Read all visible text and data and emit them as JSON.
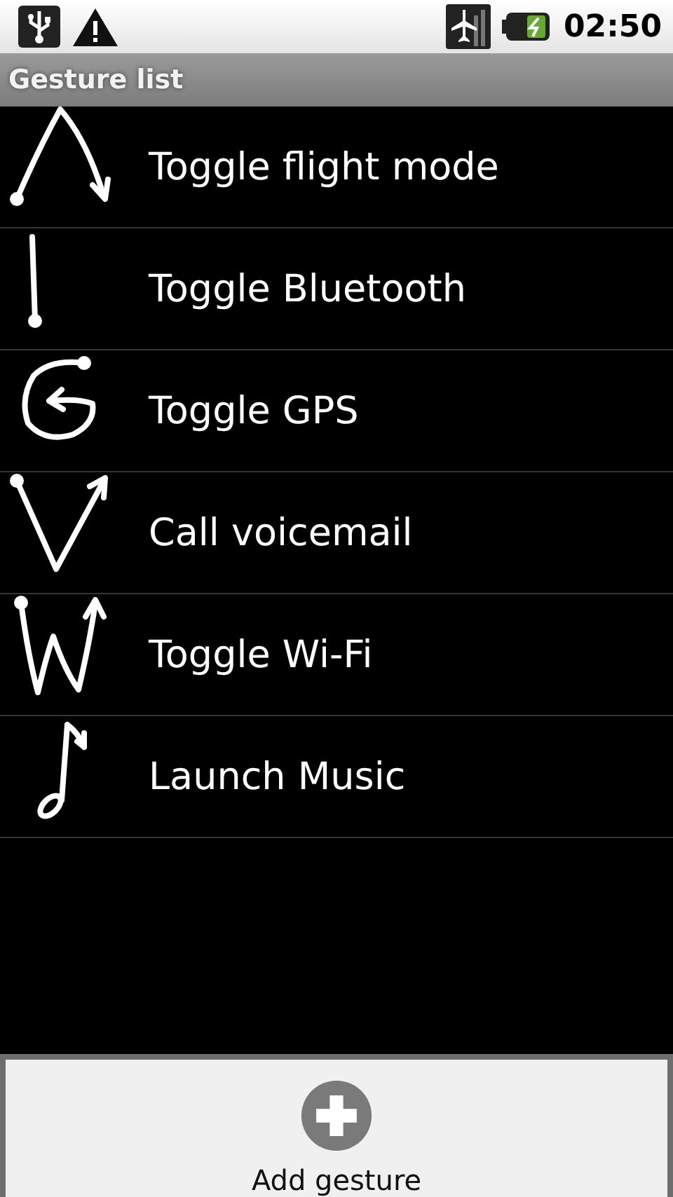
{
  "status_bar": {
    "time": "02:50"
  },
  "title_bar": {
    "title": "Gesture list"
  },
  "gestures": [
    {
      "label": "Toggle flight mode"
    },
    {
      "label": "Toggle Bluetooth"
    },
    {
      "label": "Toggle GPS"
    },
    {
      "label": "Call voicemail"
    },
    {
      "label": "Toggle Wi-Fi"
    },
    {
      "label": "Launch Music"
    }
  ],
  "add_button": {
    "label": "Add gesture"
  }
}
